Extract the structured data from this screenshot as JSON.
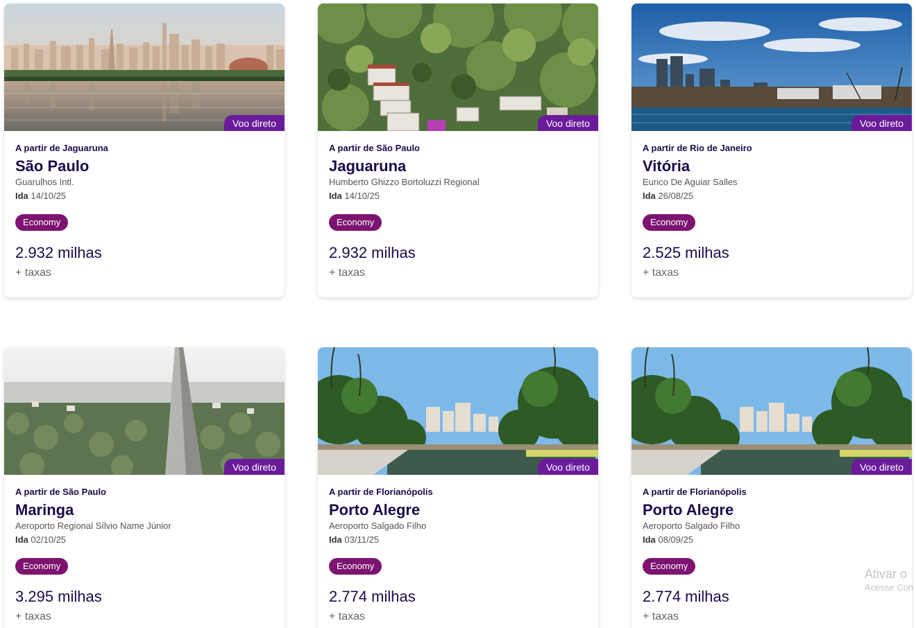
{
  "cards": [
    {
      "badge": "Voo direto",
      "origin": "A partir de Jaguaruna",
      "city": "São Paulo",
      "airport": "Guarulhos Intl.",
      "date_label": "Ida",
      "date": "14/10/25",
      "fare": "Economy",
      "miles": "2.932 milhas",
      "taxes": "+ taxas"
    },
    {
      "badge": "Voo direto",
      "origin": "A partir de São Paulo",
      "city": "Jaguaruna",
      "airport": "Humberto Ghizzo Bortoluzzi Regional",
      "date_label": "Ida",
      "date": "14/10/25",
      "fare": "Economy",
      "miles": "2.932 milhas",
      "taxes": "+ taxas"
    },
    {
      "badge": "Voo direto",
      "origin": "A partir de Rio de Janeiro",
      "city": "Vitória",
      "airport": "Eurico De Aguiar Salles",
      "date_label": "Ida",
      "date": "26/08/25",
      "fare": "Economy",
      "miles": "2.525 milhas",
      "taxes": "+ taxas"
    },
    {
      "badge": "Voo direto",
      "origin": "A partir de São Paulo",
      "city": "Maringa",
      "airport": "Aeroporto Regional Sílvio Name Júnior",
      "date_label": "Ida",
      "date": "02/10/25",
      "fare": "Economy",
      "miles": "3.295 milhas",
      "taxes": "+ taxas"
    },
    {
      "badge": "Voo direto",
      "origin": "A partir de Florianópolis",
      "city": "Porto Alegre",
      "airport": "Aeroporto Salgado Filho",
      "date_label": "Ida",
      "date": "03/11/25",
      "fare": "Economy",
      "miles": "2.774 milhas",
      "taxes": "+ taxas"
    },
    {
      "badge": "Voo direto",
      "origin": "A partir de Florianópolis",
      "city": "Porto Alegre",
      "airport": "Aeroporto Salgado Filho",
      "date_label": "Ida",
      "date": "08/09/25",
      "fare": "Economy",
      "miles": "2.774 milhas",
      "taxes": "+ taxas"
    }
  ],
  "watermark": {
    "line1": "Ativar o",
    "line2": "Acesse Con"
  },
  "colors": {
    "brand_purple": "#6a1b9a",
    "fare_pill": "#7d1470",
    "title_navy": "#1b0a4a"
  }
}
